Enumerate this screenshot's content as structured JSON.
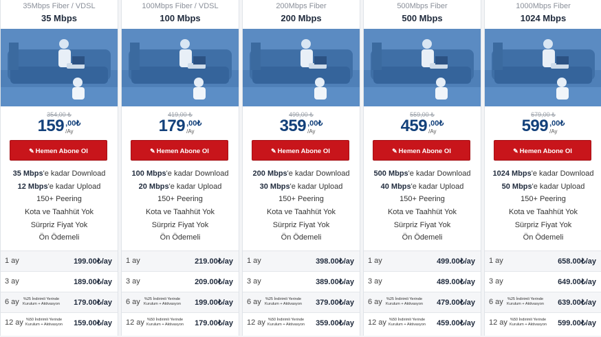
{
  "cards": [
    {
      "subtitle": "35Mbps Fiber / VDSL",
      "speed": "35 Mbps",
      "old_price": "354,00 ₺",
      "price_int": "159",
      "price_cents": ",00₺",
      "price_per": "/Ay",
      "button": "Hemen Abone Ol",
      "features": [
        {
          "bold": "35 Mbps",
          "text": "'e kadar Download"
        },
        {
          "bold": "12 Mbps",
          "text": "'e kadar Upload"
        },
        {
          "bold": "",
          "text": "150+ Peering"
        },
        {
          "bold": "",
          "text": "Kota ve Taahhüt Yok"
        },
        {
          "bold": "",
          "text": "Sürpriz Fiyat Yok"
        },
        {
          "bold": "",
          "text": "Ön Ödemeli"
        }
      ],
      "plans": [
        {
          "duration": "1 ay",
          "note1": "",
          "note2": "",
          "price": "199.00₺/ay"
        },
        {
          "duration": "3 ay",
          "note1": "",
          "note2": "",
          "price": "189.00₺/ay"
        },
        {
          "duration": "6 ay",
          "note1": "%25 İndirimli Yerinde",
          "note2": "Kurulum + Aktivasyon",
          "price": "179.00₺/ay"
        },
        {
          "duration": "12 ay",
          "note1": "%50 İndirimli Yerinde",
          "note2": "Kurulum + Aktivasyon",
          "price": "159.00₺/ay"
        }
      ]
    },
    {
      "subtitle": "100Mbps Fiber / VDSL",
      "speed": "100 Mbps",
      "old_price": "419,00 ₺",
      "price_int": "179",
      "price_cents": ",00₺",
      "price_per": "/Ay",
      "button": "Hemen Abone Ol",
      "features": [
        {
          "bold": "100 Mbps",
          "text": "'e kadar Download"
        },
        {
          "bold": "20 Mbps",
          "text": "'e kadar Upload"
        },
        {
          "bold": "",
          "text": "150+ Peering"
        },
        {
          "bold": "",
          "text": "Kota ve Taahhüt Yok"
        },
        {
          "bold": "",
          "text": "Sürpriz Fiyat Yok"
        },
        {
          "bold": "",
          "text": "Ön Ödemeli"
        }
      ],
      "plans": [
        {
          "duration": "1 ay",
          "note1": "",
          "note2": "",
          "price": "219.00₺/ay"
        },
        {
          "duration": "3 ay",
          "note1": "",
          "note2": "",
          "price": "209.00₺/ay"
        },
        {
          "duration": "6 ay",
          "note1": "%25 İndirimli Yerinde",
          "note2": "Kurulum + Aktivasyon",
          "price": "199.00₺/ay"
        },
        {
          "duration": "12 ay",
          "note1": "%50 İndirimli Yerinde",
          "note2": "Kurulum + Aktivasyon",
          "price": "179.00₺/ay"
        }
      ]
    },
    {
      "subtitle": "200Mbps Fiber",
      "speed": "200 Mbps",
      "old_price": "499,00 ₺",
      "price_int": "359",
      "price_cents": ",00₺",
      "price_per": "/Ay",
      "button": "Hemen Abone Ol",
      "features": [
        {
          "bold": "200 Mbps",
          "text": "'e kadar Download"
        },
        {
          "bold": "30 Mbps",
          "text": "'e kadar Upload"
        },
        {
          "bold": "",
          "text": "150+ Peering"
        },
        {
          "bold": "",
          "text": "Kota ve Taahhüt Yok"
        },
        {
          "bold": "",
          "text": "Sürpriz Fiyat Yok"
        },
        {
          "bold": "",
          "text": "Ön Ödemeli"
        }
      ],
      "plans": [
        {
          "duration": "1 ay",
          "note1": "",
          "note2": "",
          "price": "398.00₺/ay"
        },
        {
          "duration": "3 ay",
          "note1": "",
          "note2": "",
          "price": "389.00₺/ay"
        },
        {
          "duration": "6 ay",
          "note1": "%25 İndirimli Yerinde",
          "note2": "Kurulum + Aktivasyon",
          "price": "379.00₺/ay"
        },
        {
          "duration": "12 ay",
          "note1": "%50 İndirimli Yerinde",
          "note2": "Kurulum + Aktivasyon",
          "price": "359.00₺/ay"
        }
      ]
    },
    {
      "subtitle": "500Mbps Fiber",
      "speed": "500 Mbps",
      "old_price": "559,00 ₺",
      "price_int": "459",
      "price_cents": ",00₺",
      "price_per": "/Ay",
      "button": "Hemen Abone Ol",
      "features": [
        {
          "bold": "500 Mbps",
          "text": "'e kadar Download"
        },
        {
          "bold": "40 Mbps",
          "text": "'e kadar Upload"
        },
        {
          "bold": "",
          "text": "150+ Peering"
        },
        {
          "bold": "",
          "text": "Kota ve Taahhüt Yok"
        },
        {
          "bold": "",
          "text": "Sürpriz Fiyat Yok"
        },
        {
          "bold": "",
          "text": "Ön Ödemeli"
        }
      ],
      "plans": [
        {
          "duration": "1 ay",
          "note1": "",
          "note2": "",
          "price": "499.00₺/ay"
        },
        {
          "duration": "3 ay",
          "note1": "",
          "note2": "",
          "price": "489.00₺/ay"
        },
        {
          "duration": "6 ay",
          "note1": "%25 İndirimli Yerinde",
          "note2": "Kurulum + Aktivasyon",
          "price": "479.00₺/ay"
        },
        {
          "duration": "12 ay",
          "note1": "%50 İndirimli Yerinde",
          "note2": "Kurulum + Aktivasyon",
          "price": "459.00₺/ay"
        }
      ]
    },
    {
      "subtitle": "1000Mbps Fiber",
      "speed": "1024 Mbps",
      "old_price": "679,00 ₺",
      "price_int": "599",
      "price_cents": ",00₺",
      "price_per": "/Ay",
      "button": "Hemen Abone Ol",
      "features": [
        {
          "bold": "1024 Mbps",
          "text": "'e kadar Download"
        },
        {
          "bold": "50 Mbps",
          "text": "'e kadar Upload"
        },
        {
          "bold": "",
          "text": "150+ Peering"
        },
        {
          "bold": "",
          "text": "Kota ve Taahhüt Yok"
        },
        {
          "bold": "",
          "text": "Sürpriz Fiyat Yok"
        },
        {
          "bold": "",
          "text": "Ön Ödemeli"
        }
      ],
      "plans": [
        {
          "duration": "1 ay",
          "note1": "",
          "note2": "",
          "price": "658.00₺/ay"
        },
        {
          "duration": "3 ay",
          "note1": "",
          "note2": "",
          "price": "649.00₺/ay"
        },
        {
          "duration": "6 ay",
          "note1": "%25 İndirimli Yerinde",
          "note2": "Kurulum + Aktivasyon",
          "price": "639.00₺/ay"
        },
        {
          "duration": "12 ay",
          "note1": "%50 İndirimli Yerinde",
          "note2": "Kurulum + Aktivasyon",
          "price": "599.00₺/ay"
        }
      ]
    }
  ],
  "colors": {
    "brand_blue": "#12407a",
    "button_red": "#c8151b",
    "photo_tint": "#4a7bb4"
  },
  "icons": {
    "button_icon": "pencil-icon",
    "photo": "family-photo"
  }
}
